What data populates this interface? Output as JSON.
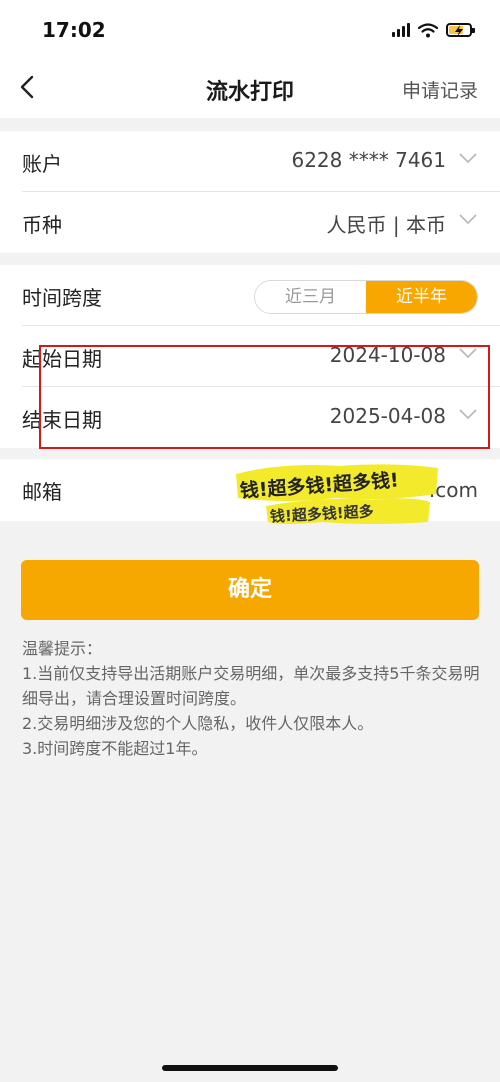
{
  "status_bar": {
    "time": "17:02"
  },
  "nav": {
    "title": "流水打印",
    "right_action": "申请记录"
  },
  "account_group": {
    "account": {
      "label": "账户",
      "value": "6228 **** 7461"
    },
    "currency": {
      "label": "币种",
      "value": "人民币 | 本币"
    }
  },
  "date_group": {
    "span": {
      "label": "时间跨度",
      "options": [
        "近三月",
        "近半年"
      ],
      "selected": "近半年"
    },
    "start": {
      "label": "起始日期",
      "value": "2024-10-08"
    },
    "end": {
      "label": "结束日期",
      "value": "2025-04-08"
    }
  },
  "email": {
    "label": "邮箱",
    "value_suffix": ".com",
    "cover_text": [
      "钱!超多钱!超多钱!",
      "钱!超多钱!超多"
    ]
  },
  "confirm_label": "确定",
  "tips": {
    "title": "温馨提示：",
    "lines": [
      "1.当前仅支持导出活期账户交易明细，单次最多支持5千条交易明细导出，请合理设置时间跨度。",
      "2.交易明细涉及您的个人隐私，收件人仅限本人。",
      "3.时间跨度不能超过1年。"
    ]
  },
  "colors": {
    "accent": "#f7a800",
    "annotation": "#d21a1a",
    "background": "#f2f2f2"
  }
}
